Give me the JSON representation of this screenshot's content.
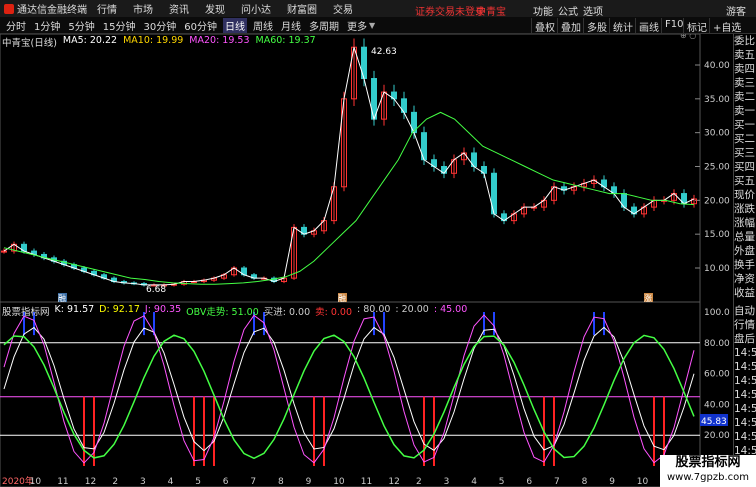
{
  "titlebar": {
    "app_name": "通达信金融终端",
    "menu": [
      "行情",
      "市场",
      "资讯",
      "发现",
      "问小达",
      "财富圈",
      "交易"
    ],
    "notice": "证券交易未登录",
    "stock_name": "中青宝",
    "right": [
      "功能",
      "公式",
      "选项",
      "游客"
    ]
  },
  "toolbar": {
    "periods": [
      "分时",
      "1分钟",
      "5分钟",
      "15分钟",
      "30分钟",
      "60分钟",
      "日线",
      "周线",
      "月线",
      "多周期",
      "更多"
    ],
    "active_period": "日线",
    "right_buttons": [
      "叠权",
      "叠加",
      "多股",
      "统计",
      "画线",
      "F10",
      "标记",
      "+自选"
    ]
  },
  "main_chart": {
    "title": "中青宝(日线)",
    "ma": [
      {
        "label": "MA5: 20.22",
        "color": "#ffffff"
      },
      {
        "label": "MA10: 19.99",
        "color": "#ffd700"
      },
      {
        "label": "MA20: 19.53",
        "color": "#ff55ff"
      },
      {
        "label": "MA60: 19.37",
        "color": "#44ff44"
      }
    ],
    "y_ticks": [
      "40.00",
      "35.00",
      "30.00",
      "25.00",
      "20.00",
      "15.00",
      "10.00"
    ],
    "high_label": "42.63",
    "low_label": "6.68",
    "markers": [
      "融",
      "融",
      "涨"
    ]
  },
  "indicator": {
    "name": "股票指标网",
    "items": [
      {
        "label": "K: 91.57",
        "color": "#ffffff"
      },
      {
        "label": "D: 92.17",
        "color": "#ffff00"
      },
      {
        "label": "J: 90.35",
        "color": "#ff55ff"
      },
      {
        "label": "OBV走势: 51.00",
        "color": "#44ff44"
      },
      {
        "label": "买进: 0.00",
        "color": "#cccccc"
      },
      {
        "label": "卖: 0.00",
        "color": "#ff3333"
      },
      {
        "label": ": 80.00",
        "color": "#cccccc"
      },
      {
        "label": ": 20.00",
        "color": "#cccccc"
      },
      {
        "label": ": 45.00",
        "color": "#ff55ff"
      }
    ],
    "y_ticks": [
      "100.0",
      "80.00",
      "60.00",
      "40.00",
      "20.00"
    ],
    "value_tag": "45.83"
  },
  "x_axis": [
    "2020年",
    "10",
    "11",
    "12",
    "2",
    "3",
    "4",
    "5",
    "6",
    "7",
    "8",
    "9",
    "10",
    "11",
    "12",
    "2",
    "3",
    "4",
    "5",
    "6",
    "7",
    "8",
    "9",
    "10",
    "11",
    "12"
  ],
  "right_panel": [
    "委比",
    "卖五",
    "卖四",
    "卖三",
    "卖二",
    "卖一",
    "买一",
    "买二",
    "买三",
    "买四",
    "买五",
    "现价",
    "涨跌",
    "涨幅",
    "总量",
    "外盘",
    "换手",
    "净资",
    "收益",
    "自动",
    "行情",
    "盘后",
    "14:56",
    "14:56",
    "14:56",
    "14:56",
    "14:56",
    "14:56",
    "14:56",
    "14:56"
  ],
  "watermark": {
    "line1": "股票指标网",
    "line2": "www.7gpzb.com"
  },
  "chart_data": {
    "type": "line",
    "price_series": {
      "name": "中青宝",
      "values": [
        12.5,
        13.5,
        12.5,
        12,
        11.5,
        11,
        10.5,
        10,
        9.5,
        9,
        8.5,
        8,
        7.8,
        7.7,
        7.5,
        7.5,
        7.5,
        7.6,
        8,
        8,
        8.2,
        8.5,
        9,
        10,
        9,
        8.5,
        8.5,
        8,
        8.5,
        16,
        15,
        15.5,
        17,
        22,
        35,
        42.63,
        38,
        32,
        36,
        35,
        33,
        30,
        26,
        25,
        24,
        26,
        27,
        25,
        24,
        18,
        17,
        18,
        19,
        19,
        20,
        22,
        21.5,
        22,
        22.5,
        23,
        22,
        21,
        19,
        18,
        19,
        20,
        20,
        21,
        19.5,
        20.2
      ]
    },
    "ma60": [
      13,
      12.5,
      12,
      11.5,
      11,
      10.5,
      10,
      9.5,
      9,
      8.5,
      8.3,
      8,
      7.8,
      7.7,
      7.6,
      7.6,
      7.7,
      7.8,
      8,
      8.3,
      8.7,
      9.5,
      11,
      13,
      15,
      17,
      20,
      23,
      26,
      30,
      32,
      33,
      32,
      30,
      28,
      27,
      26,
      25,
      24,
      23,
      22.5,
      22,
      21.5,
      21,
      21,
      20.5,
      20,
      20,
      19.5,
      19.37
    ]
  }
}
